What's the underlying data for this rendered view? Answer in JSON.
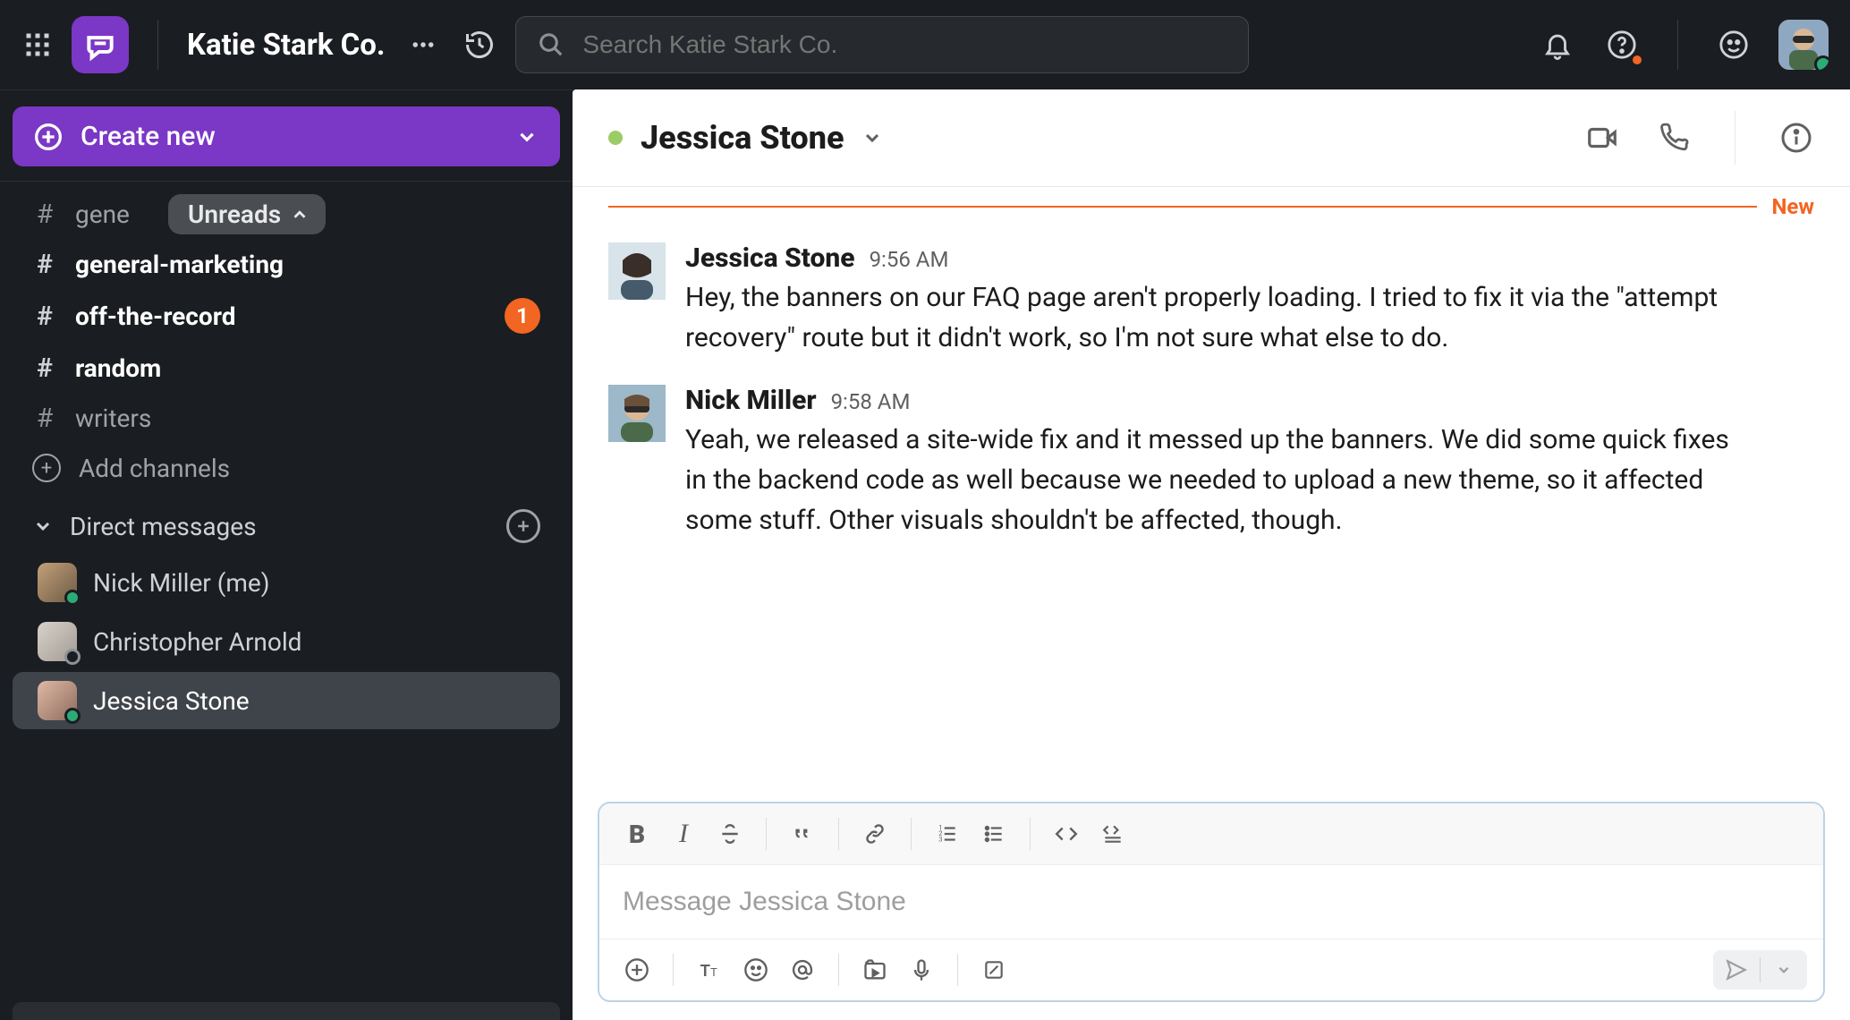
{
  "header": {
    "workspace_name": "Katie Stark Co.",
    "search_placeholder": "Search Katie Stark Co."
  },
  "sidebar": {
    "create_label": "Create new",
    "unreads_pill": "Unreads",
    "channels": [
      {
        "name": "gene",
        "bold": false,
        "badge": null
      },
      {
        "name": "general-marketing",
        "bold": true,
        "badge": null
      },
      {
        "name": "off-the-record",
        "bold": true,
        "badge": "1"
      },
      {
        "name": "random",
        "bold": true,
        "badge": null
      },
      {
        "name": "writers",
        "bold": false,
        "badge": null
      }
    ],
    "add_channels_label": "Add channels",
    "dm_section_label": "Direct messages",
    "dms": [
      {
        "name": "Nick Miller (me)",
        "presence": "online",
        "avatar": "nick"
      },
      {
        "name": "Christopher Arnold",
        "presence": "away",
        "avatar": "chris"
      },
      {
        "name": "Jessica Stone",
        "presence": "online",
        "avatar": "jess",
        "active": true
      }
    ]
  },
  "chat": {
    "title": "Jessica Stone",
    "new_label": "New",
    "messages": [
      {
        "author": "Jessica Stone",
        "time": "9:56 AM",
        "avatar": "jess",
        "text": "Hey, the banners on our FAQ page aren't properly loading. I tried to fix it via the \"attempt recovery\" route but it didn't work, so I'm not sure what else to do."
      },
      {
        "author": "Nick Miller",
        "time": "9:58 AM",
        "avatar": "nick",
        "text": "Yeah, we released a site-wide fix and it messed up the banners. We did some quick fixes in the backend code as well because we needed to upload a new theme, so it affected some stuff. Other visuals shouldn't be affected, though."
      }
    ],
    "compose_placeholder": "Message Jessica Stone"
  }
}
